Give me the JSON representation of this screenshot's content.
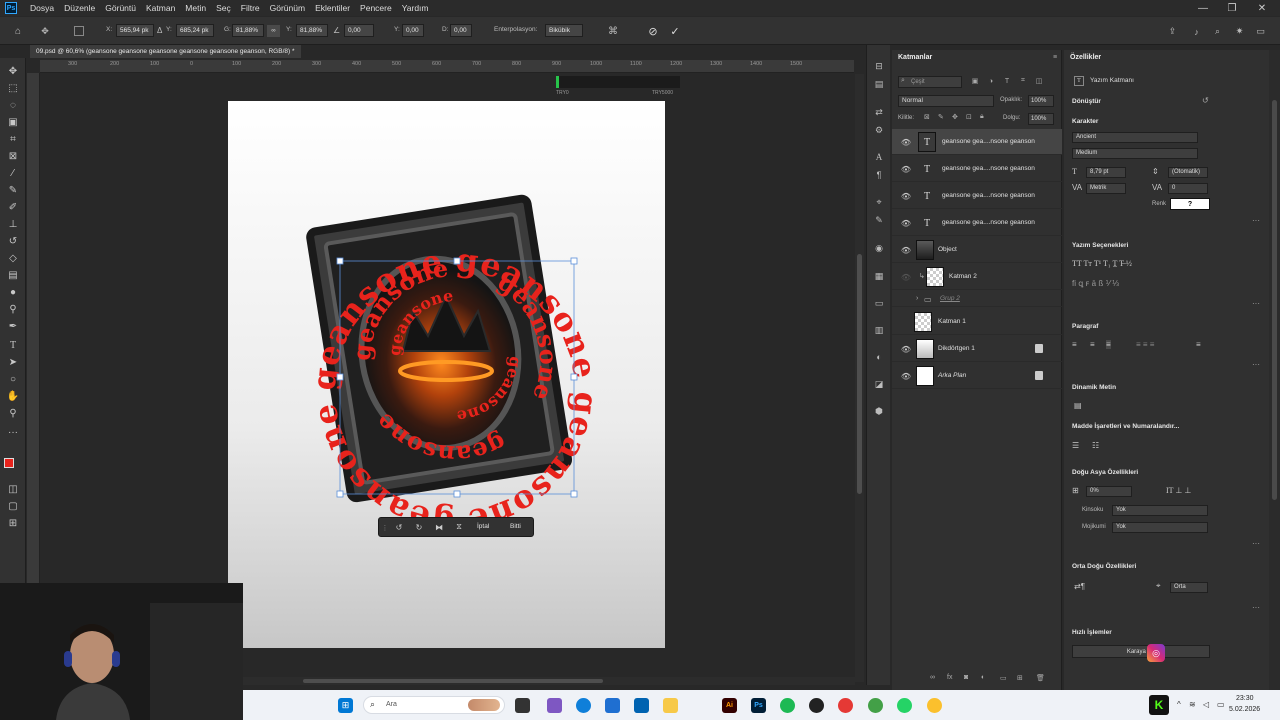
{
  "menu": {
    "app_logo": "Ps",
    "items": [
      "Dosya",
      "Düzenle",
      "Görüntü",
      "Katman",
      "Metin",
      "Seç",
      "Filtre",
      "Görünüm",
      "Eklentiler",
      "Pencere",
      "Yardım"
    ]
  },
  "options_bar": {
    "x_label": "X:",
    "x_value": "565,94 pk",
    "y_label": "Y:",
    "y_value": "685,24 pk",
    "w_label": "G:",
    "w_value": "81,88%",
    "h_label": "Y:",
    "h_value": "81,88%",
    "angle_value": "0,00",
    "hskew_label": "Y:",
    "hskew_value": "0,00",
    "vskew_label": "D:",
    "vskew_value": "0,00",
    "interp_label": "Enterpolasyon:",
    "interp_value": "Bikübik"
  },
  "document": {
    "tab_title": "09.psd @ 60,6% (geansone  geansone  geansone geansone geansone geanson, RGB/8) *",
    "rulers": [
      "300",
      "200",
      "100",
      "0",
      "100",
      "200",
      "300",
      "400",
      "500",
      "600",
      "700",
      "800",
      "900",
      "1000",
      "1100",
      "1200",
      "1300",
      "1400",
      "1500"
    ],
    "timeline_left": "TRY0",
    "timeline_right": "TRY5000"
  },
  "floating_bar": {
    "cancel": "İptal",
    "done": "Bitti"
  },
  "artwork_text": "geansone",
  "layers_panel": {
    "title": "Katmanlar",
    "search_placeholder": "Çeşit",
    "blend_mode": "Normal",
    "opacity_label": "Opaklık:",
    "opacity_value": "100%",
    "lock_label": "Kilitle:",
    "fill_label": "Dolgu:",
    "fill_value": "100%",
    "layers": [
      {
        "name": "geansone  gea....nsone geanson",
        "kind": "text",
        "visible": true,
        "selected": true
      },
      {
        "name": "geansone  gea....nsone geanson",
        "kind": "text",
        "visible": true,
        "selected": false
      },
      {
        "name": "geansone  gea....nsone geanson",
        "kind": "text",
        "visible": true,
        "selected": false
      },
      {
        "name": "geansone  gea....nsone geanson",
        "kind": "text",
        "visible": true,
        "selected": false
      },
      {
        "name": "Object",
        "kind": "image",
        "visible": true,
        "selected": false
      },
      {
        "name": "Katman 2",
        "kind": "transparent",
        "visible": false,
        "selected": false
      },
      {
        "name": "Grup 2",
        "kind": "group",
        "visible": false,
        "selected": false
      },
      {
        "name": "Katman 1",
        "kind": "transparent",
        "visible": false,
        "selected": false
      },
      {
        "name": "Dikdörtgen 1",
        "kind": "shape",
        "visible": true,
        "selected": false
      },
      {
        "name": "Arka Plan",
        "kind": "white",
        "visible": true,
        "selected": false
      }
    ]
  },
  "properties_panel": {
    "title": "Özellikler",
    "layer_type": "Yazım Katmanı",
    "transform_section": "Dönüştür",
    "character_section": "Karakter",
    "font_family": "Ancient",
    "font_style": "Medium",
    "font_size": "8,79 pt",
    "leading": "(Otomatik)",
    "kerning": "Metrik",
    "tracking": "0",
    "color_label": "Renk",
    "color_value": "#ffffff",
    "type_options_section": "Yazım Seçenekleri",
    "paragraph_section": "Paragraf",
    "dynamic_text_section": "Dinamik Metin",
    "bullets_section": "Madde İşaretleri ve Numaralandır...",
    "east_asian_section": "Doğu Asya Özellikleri",
    "east_asian_value": "0%",
    "kinsoku_label": "Kinsoku",
    "kinsoku_value": "Yok",
    "mojikumi_label": "Mojikumi",
    "mojikumi_value": "Yok",
    "middle_east_section": "Orta Doğu Özellikleri",
    "middle_east_value": "Orta",
    "quick_actions_section": "Hızlı İşlemler",
    "quick_action_button": "Karaya Dö"
  },
  "taskbar": {
    "search_placeholder": "Ara",
    "time": "23:30",
    "date": "5.02.2026"
  },
  "colors": {
    "accent_red": "#e8231c",
    "ps_blue": "#31a8ff",
    "foreground_color": "#e8231c",
    "background_color": "#000000"
  }
}
